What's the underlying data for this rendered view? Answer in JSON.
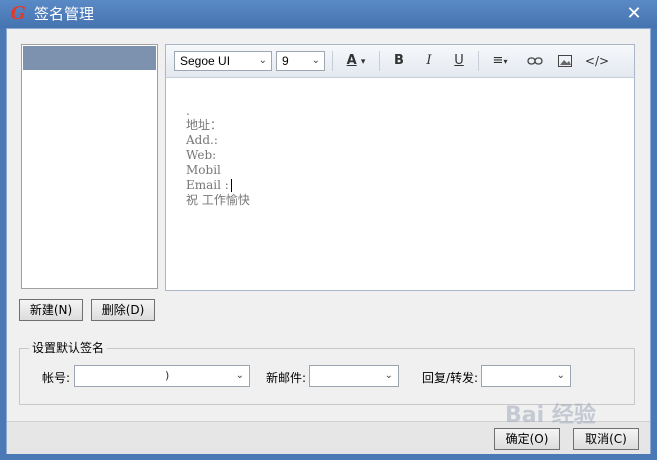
{
  "window": {
    "title": "签名管理",
    "close_glyph": "✕"
  },
  "toolbar": {
    "font_family": "Segoe UI",
    "font_size": "9",
    "icons": [
      "font-color-icon",
      "bold-icon",
      "italic-icon",
      "underline-icon",
      "align-icon",
      "link-icon",
      "image-icon",
      "source-code-icon"
    ],
    "bold": "B",
    "italic": "I",
    "underline": "U"
  },
  "signature": {
    "lines": [
      "地址：",
      "Add.:",
      "Web:",
      "Mobil",
      "Email :",
      "祝 工作愉快"
    ],
    "dot": "."
  },
  "buttons": {
    "new": "新建(N)",
    "delete": "删除(D)",
    "ok": "确定(O)",
    "cancel": "取消(C)"
  },
  "default_sig": {
    "group_title": "设置默认签名",
    "account_label": "帐号:",
    "new_mail_label": "新邮件:",
    "reply_label": "回复/转发:",
    "account_value": ")"
  },
  "watermark": "Bai 经验"
}
